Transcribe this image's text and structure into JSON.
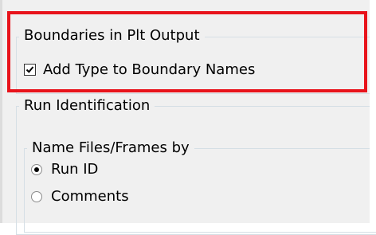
{
  "boundaries_group": {
    "title": "Boundaries in Plt Output",
    "add_type_checkbox": {
      "label": "Add Type to Boundary Names",
      "checked": true
    }
  },
  "run_identification_group": {
    "title": "Run Identification",
    "name_files_group": {
      "title": "Name Files/Frames by",
      "options": [
        {
          "label": "Run ID",
          "selected": true
        },
        {
          "label": "Comments",
          "selected": false
        }
      ]
    }
  },
  "colors": {
    "highlight": "#e8131b",
    "panel_background": "#f0f0f0",
    "group_border": "#d5dfe5"
  }
}
